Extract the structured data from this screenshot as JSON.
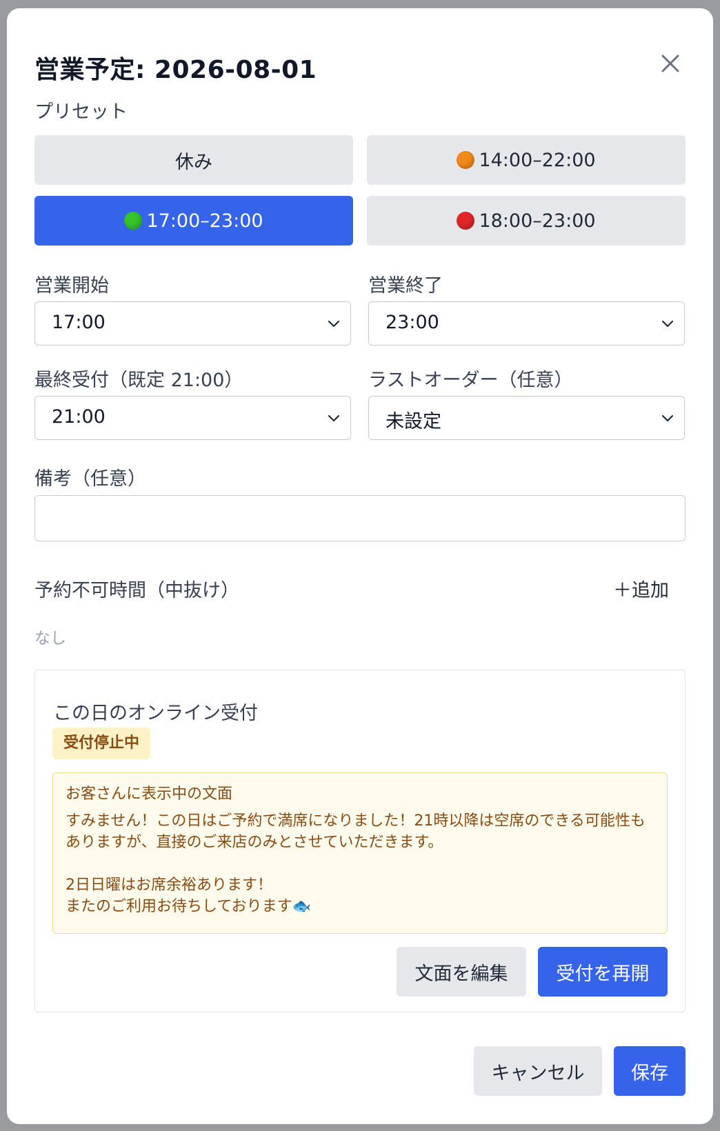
{
  "dialog": {
    "title": "営業予定: 2026-08-01"
  },
  "presets": {
    "label": "プリセット",
    "items": [
      {
        "label": "休み",
        "dot_color": null,
        "active": false
      },
      {
        "label": "14:00–22:00",
        "dot_color": "#f08a1c",
        "active": false
      },
      {
        "label": "17:00–23:00",
        "dot_color": "#34c42b",
        "active": true
      },
      {
        "label": "18:00–23:00",
        "dot_color": "#e0262a",
        "active": false
      }
    ]
  },
  "fields": {
    "open_start": {
      "label": "営業開始",
      "value": "17:00"
    },
    "open_end": {
      "label": "営業終了",
      "value": "23:00"
    },
    "last_reception": {
      "label": "最終受付（既定 21:00）",
      "value": "21:00"
    },
    "last_order": {
      "label": "ラストオーダー（任意）",
      "value": "未設定"
    },
    "note": {
      "label": "備考（任意）",
      "value": ""
    }
  },
  "blackout": {
    "label": "予約不可時間（中抜け）",
    "add_label": "＋追加",
    "empty_text": "なし"
  },
  "online": {
    "title": "この日のオンライン受付",
    "status_badge": "受付停止中",
    "message_heading": "お客さんに表示中の文面",
    "message_body": "すみません！この日はご予約で満席になりました！21時以降は空席のできる可能性もありますが、直接のご来店のみとさせていただきます。\n\n2日日曜はお席余裕あります！\nまたのご利用お待ちしております🐟",
    "edit_label": "文面を編集",
    "resume_label": "受付を再開"
  },
  "footer": {
    "cancel_label": "キャンセル",
    "save_label": "保存"
  },
  "colors": {
    "primary": "#3563e9",
    "neutral_button": "#e5e7eb",
    "badge_bg": "#fdf2c6",
    "badge_text": "#8a4b12",
    "message_bg": "#fefbec",
    "message_border": "#f3dd8c"
  },
  "icons": {
    "close": "close-icon",
    "select": "chevron-down-icon"
  }
}
